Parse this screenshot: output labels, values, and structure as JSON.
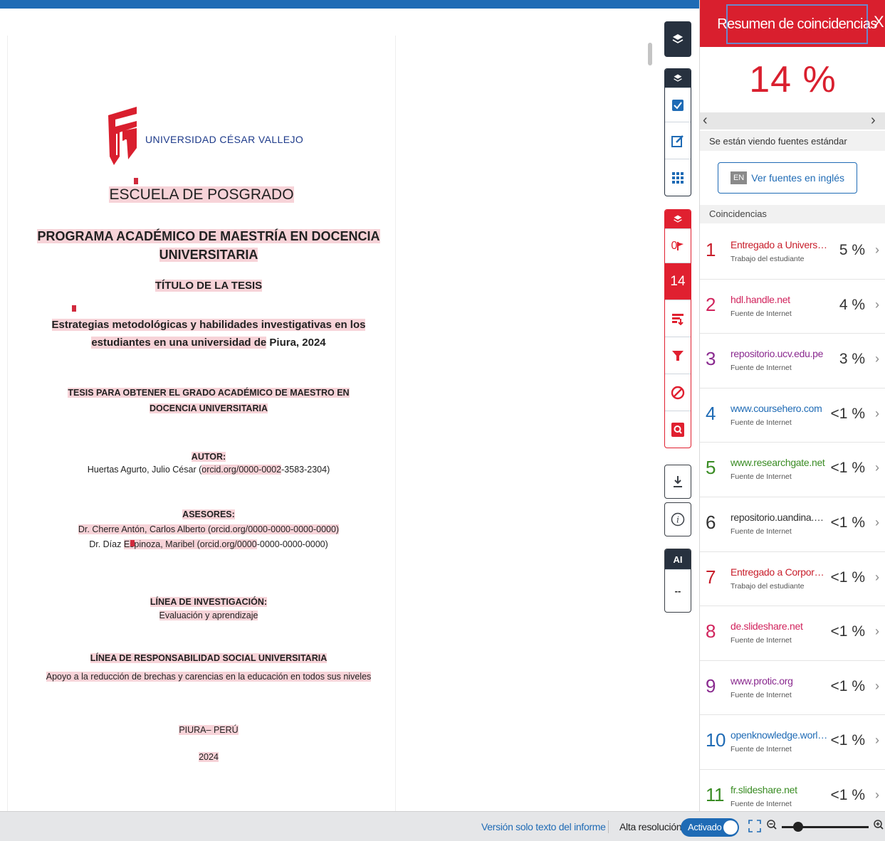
{
  "document": {
    "university": "UNIVERSIDAD CÉSAR VALLEJO",
    "school": "ESCUELA DE POSGRADO",
    "program_line1": "PROGRAMA ACADÉMICO DE MAESTRÍA EN DOCENCIA",
    "program_line2": "UNIVERSITARIA",
    "title_heading": "TÍTULO DE LA TESIS",
    "title_line1": "Estrategias metodológicas y habilidades investigativas en los",
    "title_line2_a": "estudiantes en una universidad de",
    "title_line2_b": " Piura, 2024",
    "degree_line1": "TESIS PARA OBTENER EL GRADO ACADÉMICO DE MAESTRO EN",
    "degree_line2": "DOCENCIA UNIVERSITARIA",
    "author_heading": "AUTOR:",
    "author_a": "Huertas Agurto, Julio César (",
    "author_b": "orcid.org/0000-0002",
    "author_c": "-3583-2304)",
    "advisors_heading": "ASESORES:",
    "advisor1": "Dr. Cherre Antón, Carlos Alberto (orcid.org/0000-0000-0000-0000)",
    "advisor2_a": "Dr. Díaz ",
    "advisor2_b": "Espinoza, Maribel (orcid.org/0000",
    "advisor2_c": "-0000-0000-0000)",
    "research_heading": "LÍNEA DE INVESTIGACIÓN:",
    "research_line": "Evaluación y aprendizaje",
    "social_heading": "LÍNEA DE RESPONSABILIDAD SOCIAL UNIVERSITARIA",
    "social_line": "Apoyo a la reducción de brechas y carencias en la educación en todos sus niveles",
    "place": "PIURA– PERÚ",
    "year": "2024"
  },
  "toolbar": {
    "flag_count": "0",
    "match_count": "14",
    "ai_label": "AI",
    "ai_value": "--",
    "icons": [
      "layers-icon",
      "checkbox-icon",
      "edit-icon",
      "grid-icon",
      "flag-icon",
      "filter-list-icon",
      "filter-icon",
      "block-icon",
      "search-doc-icon",
      "download-icon",
      "info-icon"
    ]
  },
  "panel": {
    "title": "Resumen de coincidencias",
    "close": "X",
    "percentage": "14 %",
    "viewing": "Se están viendo fuentes estándar",
    "en_badge": "EN",
    "en_button": "Ver fuentes en inglés",
    "matches_label": "Coincidencias",
    "matches": [
      {
        "num": "1",
        "source": "Entregado a Universida...",
        "type": "Trabajo del estudiante",
        "pct": "5 %",
        "color": "#c81e2b"
      },
      {
        "num": "2",
        "source": "hdl.handle.net",
        "type": "Fuente de Internet",
        "pct": "4 %",
        "color": "#d1245d"
      },
      {
        "num": "3",
        "source": "repositorio.ucv.edu.pe",
        "type": "Fuente de Internet",
        "pct": "3 %",
        "color": "#8a2a8f"
      },
      {
        "num": "4",
        "source": "www.coursehero.com",
        "type": "Fuente de Internet",
        "pct": "<1 %",
        "color": "#1f6bb5"
      },
      {
        "num": "5",
        "source": "www.researchgate.net",
        "type": "Fuente de Internet",
        "pct": "<1 %",
        "color": "#3a8c24"
      },
      {
        "num": "6",
        "source": "repositorio.uandina.ed...",
        "type": "Fuente de Internet",
        "pct": "<1 %",
        "color": "#333333"
      },
      {
        "num": "7",
        "source": "Entregado a Corporaci...",
        "type": "Trabajo del estudiante",
        "pct": "<1 %",
        "color": "#c81e2b"
      },
      {
        "num": "8",
        "source": "de.slideshare.net",
        "type": "Fuente de Internet",
        "pct": "<1 %",
        "color": "#d1245d"
      },
      {
        "num": "9",
        "source": "www.protic.org",
        "type": "Fuente de Internet",
        "pct": "<1 %",
        "color": "#8a2a8f"
      },
      {
        "num": "10",
        "source": "openknowledge.worldb...",
        "type": "Fuente de Internet",
        "pct": "<1 %",
        "color": "#1f6bb5"
      },
      {
        "num": "11",
        "source": "fr.slideshare.net",
        "type": "Fuente de Internet",
        "pct": "<1 %",
        "color": "#3a8c24"
      }
    ]
  },
  "bottombar": {
    "text_version": "Versión solo texto del informe",
    "high_res": "Alta resolución",
    "toggle_label": "Activado"
  },
  "colors": {
    "accent_red": "#d91f2e",
    "accent_blue": "#1f6bb5",
    "toolbar_dark": "#27313f",
    "highlight": "#f7d3d8"
  }
}
